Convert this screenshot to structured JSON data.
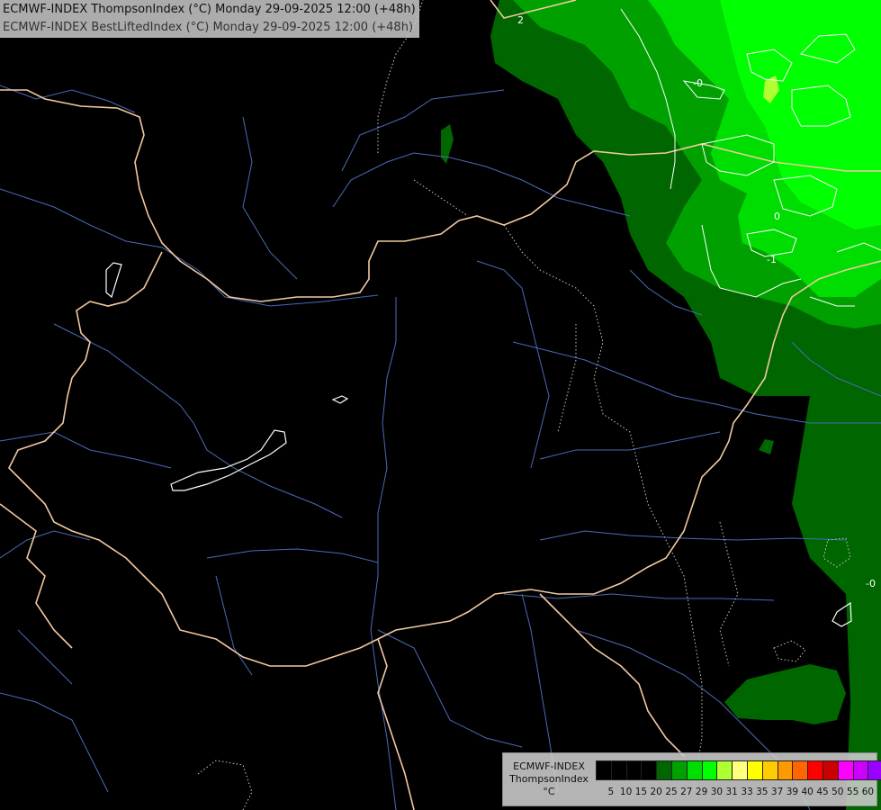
{
  "title": {
    "line1": "ECMWF-INDEX ThompsonIndex (°C) Monday 29-09-2025 12:00 (+48h)",
    "line2": "ECMWF-INDEX BestLiftedIndex (°C) Monday 29-09-2025 12:00 (+48h)"
  },
  "map": {
    "background_color": "#000000",
    "border_color": "#f1c9a0",
    "river_color": "#4a6ab8",
    "contour_color": "#ffffff",
    "contour_labels": [
      "2",
      "-0",
      "0",
      "-1",
      "-0"
    ],
    "field_colors": {
      "level_20": "#006600",
      "level_25": "#00a000",
      "level_27": "#00dd00",
      "level_29": "#00ff00",
      "level_30": "#b0ff30"
    }
  },
  "legend": {
    "title_line1": "ECMWF-INDEX",
    "title_line2": "ThompsonIndex",
    "unit": "°C",
    "colors": [
      "#000000",
      "#000000",
      "#000000",
      "#000000",
      "#006600",
      "#00a000",
      "#00dd00",
      "#00ff00",
      "#b0ff30",
      "#ffff80",
      "#ffff00",
      "#ffcc00",
      "#ff9900",
      "#ff6600",
      "#ff0000",
      "#cc0000",
      "#ff00ff",
      "#cc00ff",
      "#9900ff",
      "#6600ff",
      "#0000ff"
    ],
    "ticks": [
      "5",
      "10",
      "15",
      "20",
      "25",
      "27",
      "29",
      "30",
      "31",
      "33",
      "35",
      "37",
      "39",
      "40",
      "45",
      "50",
      "55",
      "60"
    ]
  }
}
